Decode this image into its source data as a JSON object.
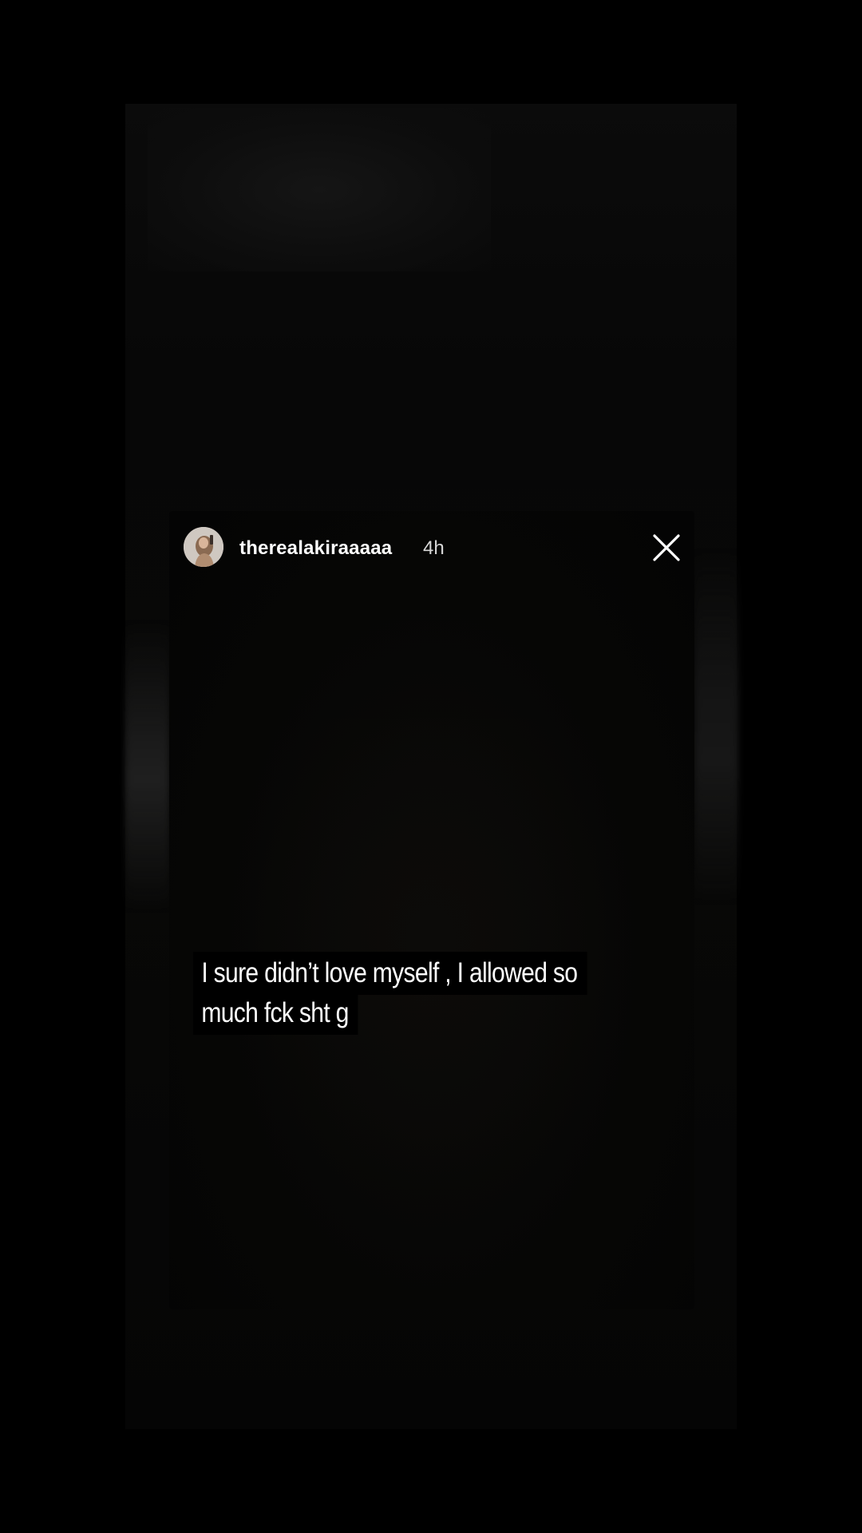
{
  "story": {
    "username": "therealakiraaaaa",
    "timestamp": "4h",
    "caption_lines": [
      "I sure didn’t love myself , I allowed so",
      "much fck sht g"
    ]
  },
  "icons": {
    "close": "close-icon",
    "avatar": "avatar"
  },
  "colors": {
    "background": "#000000",
    "text": "#ffffff",
    "timestamp": "#d8d8d8"
  }
}
